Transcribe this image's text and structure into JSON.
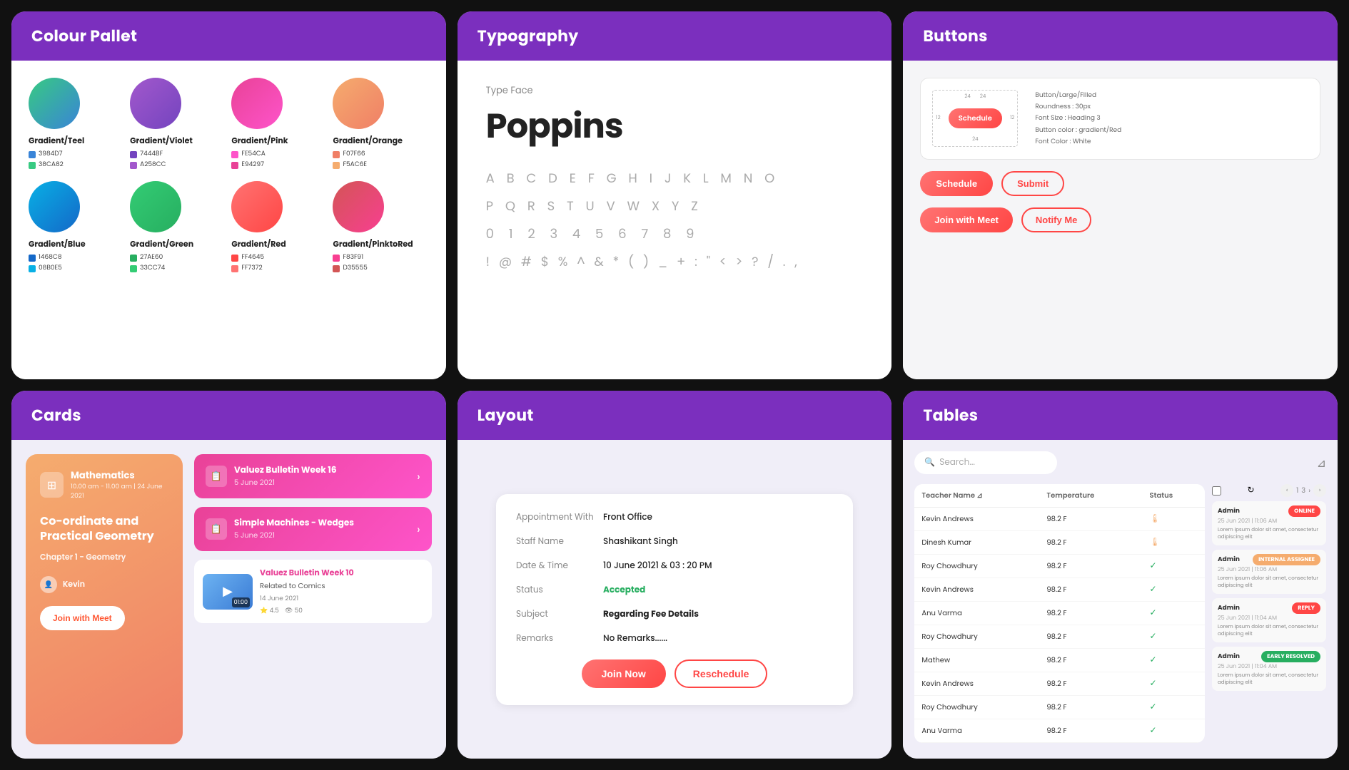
{
  "panels": {
    "colour_pallet": {
      "title": "Colour Pallet",
      "colours": [
        {
          "id": "teal",
          "label": "Gradient/Teel",
          "class": "grad-teal",
          "swatches": [
            {
              "hex": "3984D7",
              "color": "#3984D7"
            },
            {
              "hex": "38CA82",
              "color": "#38CA82"
            }
          ]
        },
        {
          "id": "violet",
          "label": "Gradient/Violet",
          "class": "grad-violet",
          "swatches": [
            {
              "hex": "7444BF",
              "color": "#7444BF"
            },
            {
              "hex": "A258CC",
              "color": "#A258CC"
            }
          ]
        },
        {
          "id": "pink",
          "label": "Gradient/Pink",
          "class": "grad-pink",
          "swatches": [
            {
              "hex": "FE54CA",
              "color": "#FE54CA"
            },
            {
              "hex": "E94297",
              "color": "#E94297"
            }
          ]
        },
        {
          "id": "orange",
          "label": "Gradient/Orange",
          "class": "grad-orange",
          "swatches": [
            {
              "hex": "F07F66",
              "color": "#F07F66"
            },
            {
              "hex": "F5AC6E",
              "color": "#F5AC6E"
            }
          ]
        },
        {
          "id": "blue",
          "label": "Gradient/Blue",
          "class": "grad-blue",
          "swatches": [
            {
              "hex": "1468C8",
              "color": "#1468C8"
            },
            {
              "hex": "08B0E5",
              "color": "#08B0E5"
            }
          ]
        },
        {
          "id": "green",
          "label": "Gradient/Green",
          "class": "grad-green",
          "swatches": [
            {
              "hex": "27AE60",
              "color": "#27AE60"
            },
            {
              "hex": "33CC74",
              "color": "#33CC74"
            }
          ]
        },
        {
          "id": "red",
          "label": "Gradient/Red",
          "class": "grad-red",
          "swatches": [
            {
              "hex": "FF4645",
              "color": "#FF4645"
            },
            {
              "hex": "FF7372",
              "color": "#FF7372"
            }
          ]
        },
        {
          "id": "pinkred",
          "label": "Gradient/PinktoRed",
          "class": "grad-pinkred",
          "swatches": [
            {
              "hex": "F83F91",
              "color": "#F83F91"
            },
            {
              "hex": "D35555",
              "color": "#D35555"
            }
          ]
        }
      ]
    },
    "typography": {
      "title": "Typography",
      "typeface_label": "Type Face",
      "typeface_name": "Poppins",
      "alphabet_upper": "A B C D E F G H I J K L M N O",
      "alphabet_lower": "P Q R S T U V W X Y Z",
      "numbers": "0 1 2 3 4 5 6 7 8 9",
      "special": "! @ # $ % ^ & * ( ) _ + : \" < > ? / . ,"
    },
    "buttons": {
      "title": "Buttons",
      "spec_title": "Button/Large/Filled",
      "spec_roundness": "Roundness : 30px",
      "spec_font_size": "Font Size : Heading 3",
      "spec_bg_color": "Button color : gradient/Red",
      "spec_font_color": "Font Color : White",
      "btn_schedule_label": "Schedule",
      "btn_submit_label": "Submit",
      "btn_join_meet_label": "Join with Meet",
      "btn_notify_label": "Notify Me"
    },
    "cards": {
      "title": "Cards",
      "left_card": {
        "subject": "Mathematics",
        "time": "10.00 am - 11.00 am | 24 June 2021",
        "chapter": "Co-ordinate and Practical Geometry",
        "sub_chapter": "Chapter 1 - Geometry",
        "teacher": "Kevin",
        "join_btn": "Join with Meet"
      },
      "list_cards": [
        {
          "title": "Valuez Bulletin Week 16",
          "date": "5 June 2021"
        },
        {
          "title": "Simple Machines - Wedges",
          "date": "5 June 2021"
        }
      ],
      "video_card": {
        "title": "Valuez Bulletin Week 10",
        "subtitle": "Related to Comics",
        "date": "14 June 2021",
        "duration": "01:00",
        "rating": "4.5",
        "views": "50"
      }
    },
    "layout": {
      "title": "Layout",
      "appointment": {
        "label_appointment": "Appointment With",
        "value_appointment": "Front Office",
        "label_staff": "Staff Name",
        "value_staff": "Shashikant Singh",
        "label_datetime": "Date & Time",
        "value_datetime": "10 June 20121 & 03 : 20 PM",
        "label_status": "Status",
        "value_status": "Accepted",
        "label_subject": "Subject",
        "value_subject": "Regarding Fee Details",
        "label_remarks": "Remarks",
        "value_remarks": "No Remarks......",
        "btn_join": "Join Now",
        "btn_reschedule": "Reschedule"
      }
    },
    "tables": {
      "title": "Tables",
      "search_placeholder": "Search...",
      "columns": [
        "Teacher Name",
        "Temperature",
        "Status"
      ],
      "rows": [
        {
          "name": "Kevin Andrews",
          "temp": "98.2 F",
          "status": "temp"
        },
        {
          "name": "Dinesh Kumar",
          "temp": "98.2 F",
          "status": "temp"
        },
        {
          "name": "Roy Chowdhury",
          "temp": "98.2 F",
          "status": "check"
        },
        {
          "name": "Kevin Andrews",
          "temp": "98.2 F",
          "status": "check"
        },
        {
          "name": "Anu Varma",
          "temp": "98.2 F",
          "status": "check"
        },
        {
          "name": "Roy Chowdhury",
          "temp": "98.2 F",
          "status": "check"
        },
        {
          "name": "Mathew",
          "temp": "98.2 F",
          "status": "check"
        },
        {
          "name": "Kevin Andrews",
          "temp": "98.2 F",
          "status": "check"
        },
        {
          "name": "Roy Chowdhury",
          "temp": "98.2 F",
          "status": "check"
        },
        {
          "name": "Anu Varma",
          "temp": "98.2 F",
          "status": "check"
        }
      ],
      "side_items": [
        {
          "badge": "ONLINE",
          "badge_color": "status-online",
          "name": "Admin",
          "date": "25 Jun 2021 | 11:06 AM",
          "text": "Lorem ipsum dolor sit amet, consectetur adipiscing elit"
        },
        {
          "badge": "INTERNAL ASSIGNEE",
          "badge_color": "status-orange",
          "name": "Admin",
          "date": "25 Jun 2021 | 11:06 AM",
          "text": "Lorem ipsum dolor sit amet, consectetur adipiscing elit"
        },
        {
          "badge": "REPLY",
          "badge_color": "status-online",
          "name": "Admin",
          "date": "25 Jun 2021 | 11:04 AM",
          "text": "Lorem ipsum dolor sit amet, consectetur adipiscing elit"
        },
        {
          "badge": "EARLY RESOLVED",
          "badge_color": "status-green",
          "name": "Admin",
          "date": "25 Jun 2021 | 11:04 AM",
          "text": "Lorem ipsum dolor sit amet, consectetur adipiscing elit"
        }
      ]
    }
  }
}
